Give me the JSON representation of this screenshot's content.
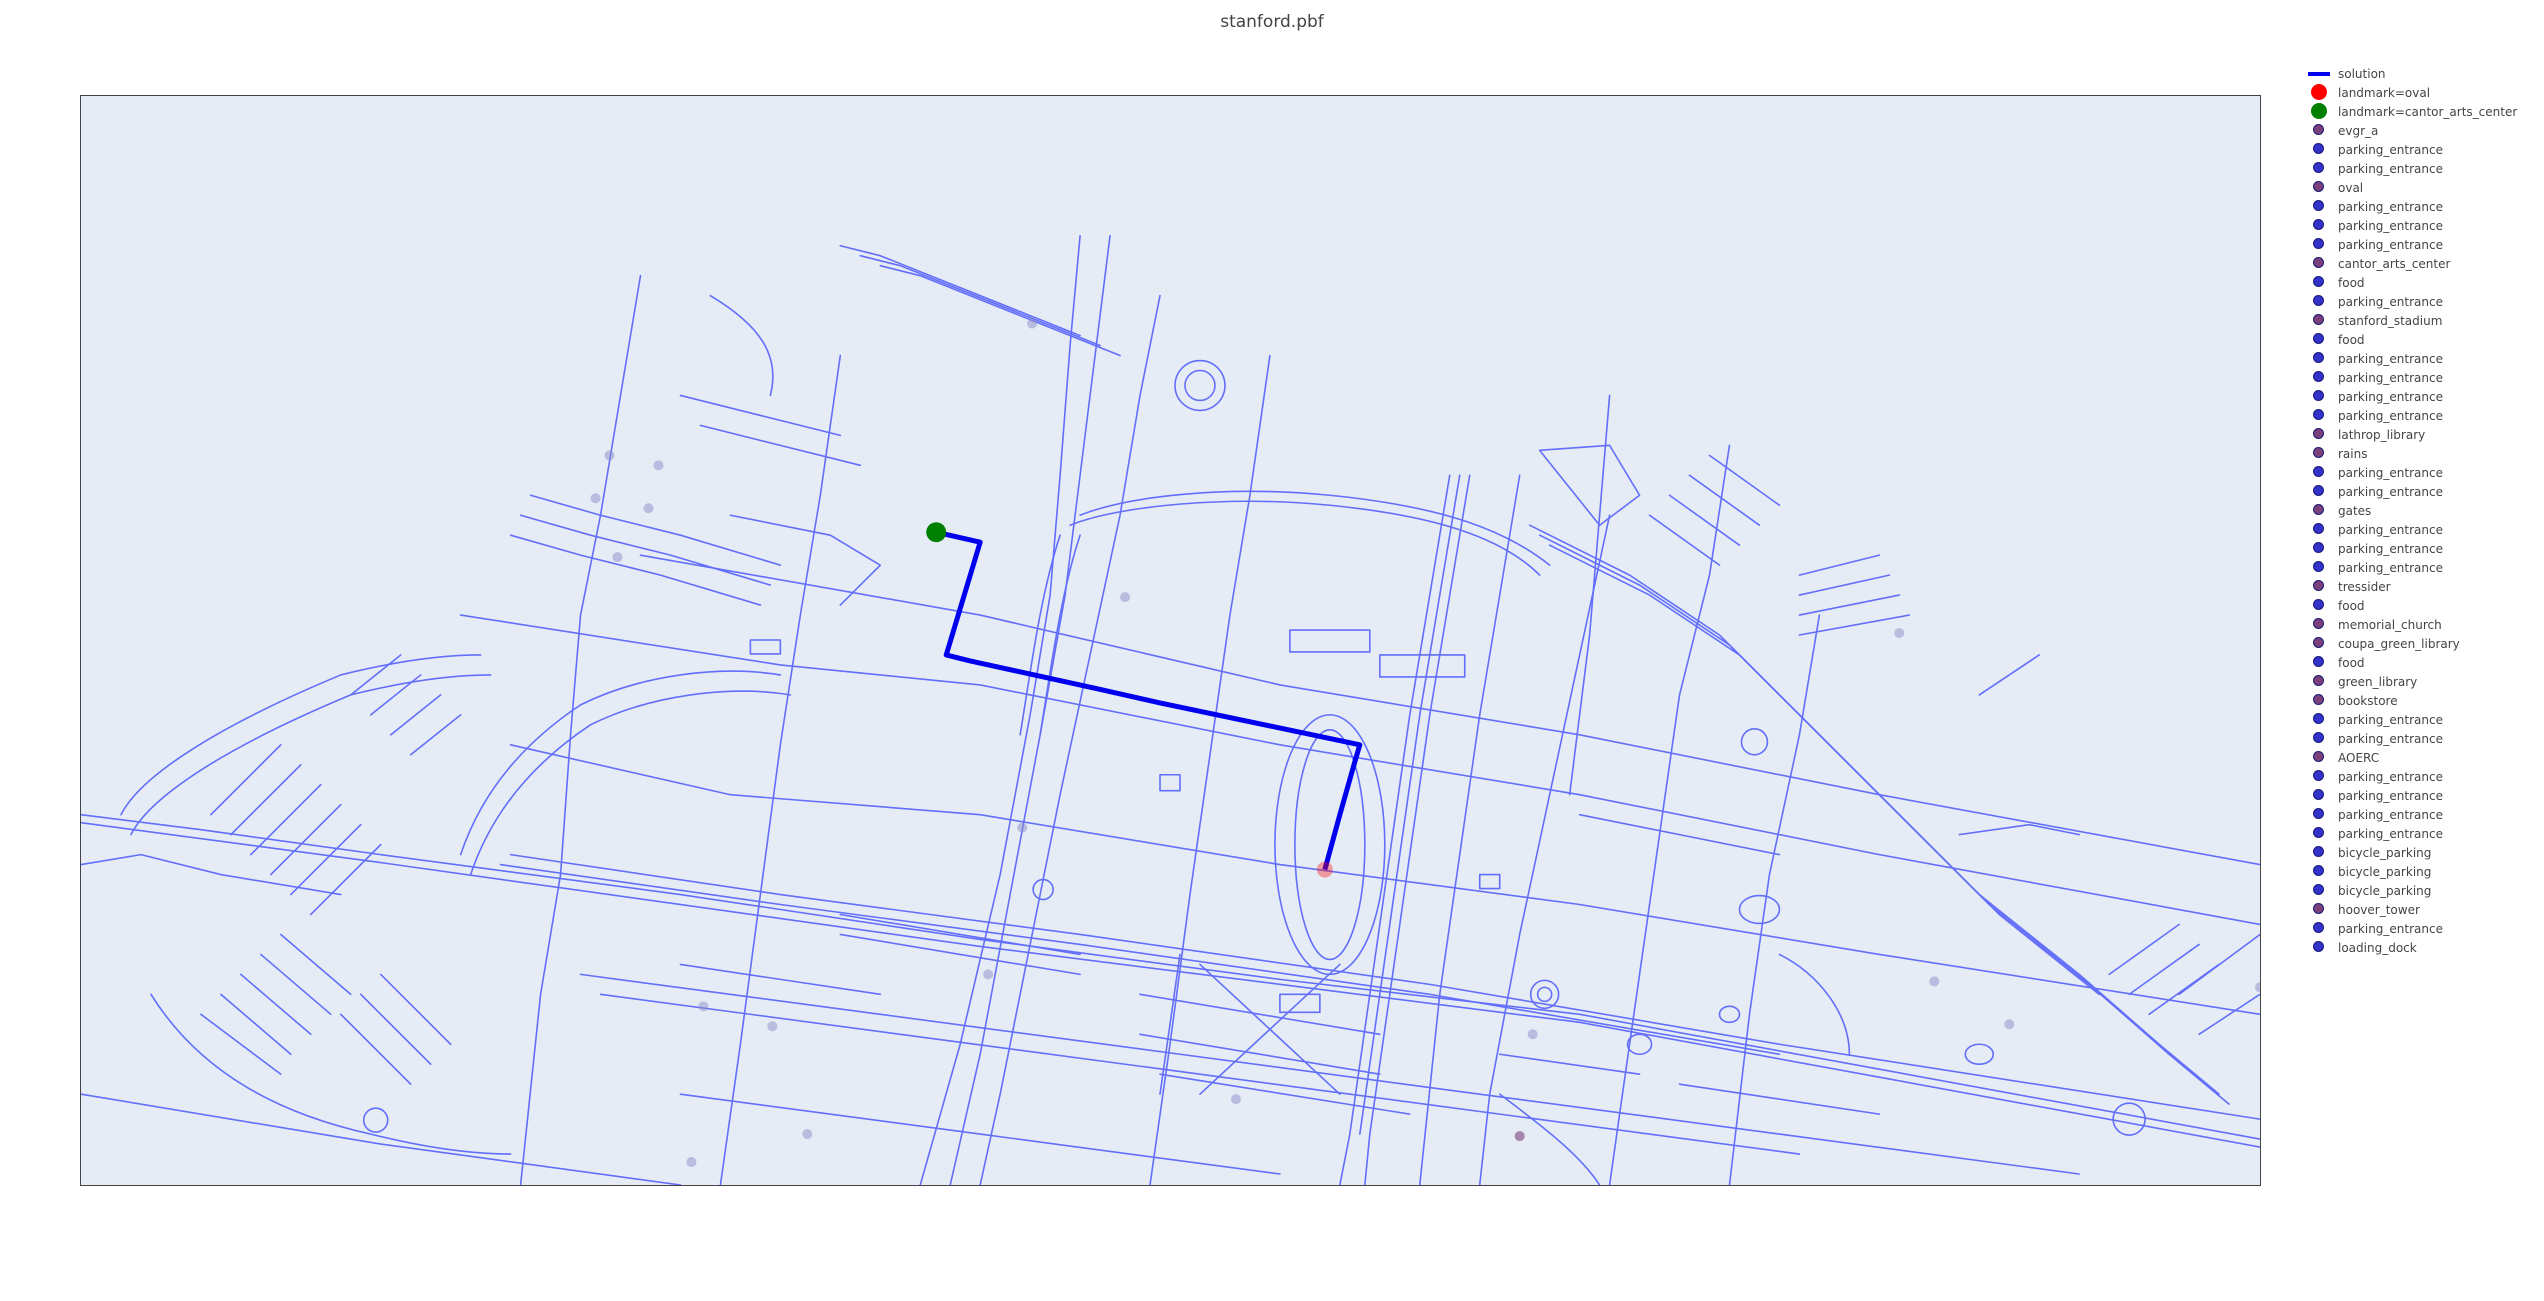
{
  "title": "stanford.pbf",
  "colors": {
    "road": "#636efa",
    "solution": "#0000ee",
    "start": "#008000",
    "goal": "#ff0000",
    "poi_landmark": "#7b3f7b",
    "poi_other": "#3232c8",
    "plot_bg": "#e5ecf6"
  },
  "legend": [
    {
      "label": "solution",
      "kind": "line",
      "color": "#0000ee"
    },
    {
      "label": "landmark=oval",
      "kind": "big-dot",
      "color": "#ff0000"
    },
    {
      "label": "landmark=cantor_arts_center",
      "kind": "big-dot",
      "color": "#008000"
    },
    {
      "label": "evgr_a",
      "kind": "dot",
      "color": "#7b3f7b"
    },
    {
      "label": "parking_entrance",
      "kind": "dot",
      "color": "#3232c8"
    },
    {
      "label": "parking_entrance",
      "kind": "dot",
      "color": "#3232c8"
    },
    {
      "label": "oval",
      "kind": "dot",
      "color": "#7b3f7b"
    },
    {
      "label": "parking_entrance",
      "kind": "dot",
      "color": "#3232c8"
    },
    {
      "label": "parking_entrance",
      "kind": "dot",
      "color": "#3232c8"
    },
    {
      "label": "parking_entrance",
      "kind": "dot",
      "color": "#3232c8"
    },
    {
      "label": "cantor_arts_center",
      "kind": "dot",
      "color": "#7b3f7b"
    },
    {
      "label": "food",
      "kind": "dot",
      "color": "#3232c8"
    },
    {
      "label": "parking_entrance",
      "kind": "dot",
      "color": "#3232c8"
    },
    {
      "label": "stanford_stadium",
      "kind": "dot",
      "color": "#7b3f7b"
    },
    {
      "label": "food",
      "kind": "dot",
      "color": "#3232c8"
    },
    {
      "label": "parking_entrance",
      "kind": "dot",
      "color": "#3232c8"
    },
    {
      "label": "parking_entrance",
      "kind": "dot",
      "color": "#3232c8"
    },
    {
      "label": "parking_entrance",
      "kind": "dot",
      "color": "#3232c8"
    },
    {
      "label": "parking_entrance",
      "kind": "dot",
      "color": "#3232c8"
    },
    {
      "label": "lathrop_library",
      "kind": "dot",
      "color": "#7b3f7b"
    },
    {
      "label": "rains",
      "kind": "dot",
      "color": "#7b3f7b"
    },
    {
      "label": "parking_entrance",
      "kind": "dot",
      "color": "#3232c8"
    },
    {
      "label": "parking_entrance",
      "kind": "dot",
      "color": "#3232c8"
    },
    {
      "label": "gates",
      "kind": "dot",
      "color": "#7b3f7b"
    },
    {
      "label": "parking_entrance",
      "kind": "dot",
      "color": "#3232c8"
    },
    {
      "label": "parking_entrance",
      "kind": "dot",
      "color": "#3232c8"
    },
    {
      "label": "parking_entrance",
      "kind": "dot",
      "color": "#3232c8"
    },
    {
      "label": "tressider",
      "kind": "dot",
      "color": "#7b3f7b"
    },
    {
      "label": "food",
      "kind": "dot",
      "color": "#3232c8"
    },
    {
      "label": "memorial_church",
      "kind": "dot",
      "color": "#7b3f7b"
    },
    {
      "label": "coupa_green_library",
      "kind": "dot",
      "color": "#7b3f7b"
    },
    {
      "label": "food",
      "kind": "dot",
      "color": "#3232c8"
    },
    {
      "label": "green_library",
      "kind": "dot",
      "color": "#7b3f7b"
    },
    {
      "label": "bookstore",
      "kind": "dot",
      "color": "#7b3f7b"
    },
    {
      "label": "parking_entrance",
      "kind": "dot",
      "color": "#3232c8"
    },
    {
      "label": "parking_entrance",
      "kind": "dot",
      "color": "#3232c8"
    },
    {
      "label": "AOERC",
      "kind": "dot",
      "color": "#7b3f7b"
    },
    {
      "label": "parking_entrance",
      "kind": "dot",
      "color": "#3232c8"
    },
    {
      "label": "parking_entrance",
      "kind": "dot",
      "color": "#3232c8"
    },
    {
      "label": "parking_entrance",
      "kind": "dot",
      "color": "#3232c8"
    },
    {
      "label": "parking_entrance",
      "kind": "dot",
      "color": "#3232c8"
    },
    {
      "label": "bicycle_parking",
      "kind": "dot",
      "color": "#3232c8"
    },
    {
      "label": "bicycle_parking",
      "kind": "dot",
      "color": "#3232c8"
    },
    {
      "label": "bicycle_parking",
      "kind": "dot",
      "color": "#3232c8"
    },
    {
      "label": "hoover_tower",
      "kind": "dot",
      "color": "#7b3f7b"
    },
    {
      "label": "parking_entrance",
      "kind": "dot",
      "color": "#3232c8"
    },
    {
      "label": "loading_dock",
      "kind": "dot",
      "color": "#3232c8"
    }
  ]
}
